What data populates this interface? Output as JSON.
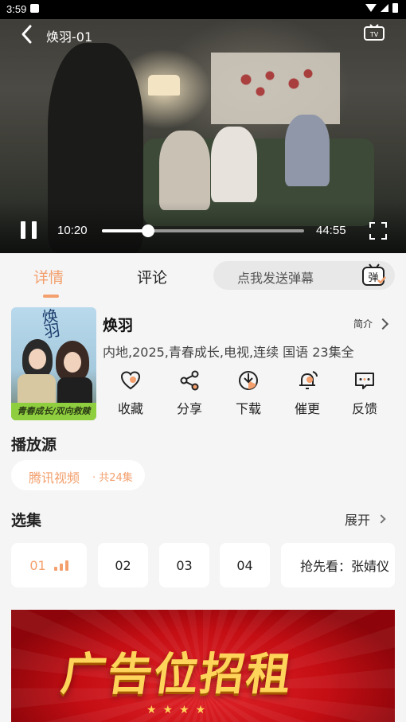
{
  "status_bar": {
    "time": "3:59"
  },
  "video": {
    "title": "焕羽-01",
    "current_time": "10:20",
    "total_time": "44:55",
    "progress": 0.23
  },
  "tabs": [
    {
      "label": "详情",
      "active": true
    },
    {
      "label": "评论",
      "active": false
    }
  ],
  "danmu": {
    "placeholder": "点我发送弹幕",
    "icon_label": "弹"
  },
  "show": {
    "title": "焕羽",
    "intro_label": "简介",
    "meta": "内地,2025,青春成长,电视,连续 国语 23集全",
    "poster_title": "焕羽",
    "poster_band": "青春成长/双向救赎"
  },
  "actions": [
    {
      "label": "收藏",
      "icon": "heart-icon"
    },
    {
      "label": "分享",
      "icon": "share-icon"
    },
    {
      "label": "下载",
      "icon": "download-icon"
    },
    {
      "label": "催更",
      "icon": "bell-icon"
    },
    {
      "label": "反馈",
      "icon": "feedback-icon"
    }
  ],
  "source": {
    "section_title": "播放源",
    "name": "腾讯视频",
    "count": "· 共24集"
  },
  "episodes": {
    "section_title": "选集",
    "expand_label": "展开",
    "items": [
      "01",
      "02",
      "03",
      "04",
      "抢先看：张婧仪"
    ]
  },
  "ad": {
    "text": "广告位招租",
    "stars": "★★★★"
  },
  "colors": {
    "accent": "#f3a06e",
    "ad_red": "#c40e14",
    "ad_gold": "#ffd45a"
  }
}
